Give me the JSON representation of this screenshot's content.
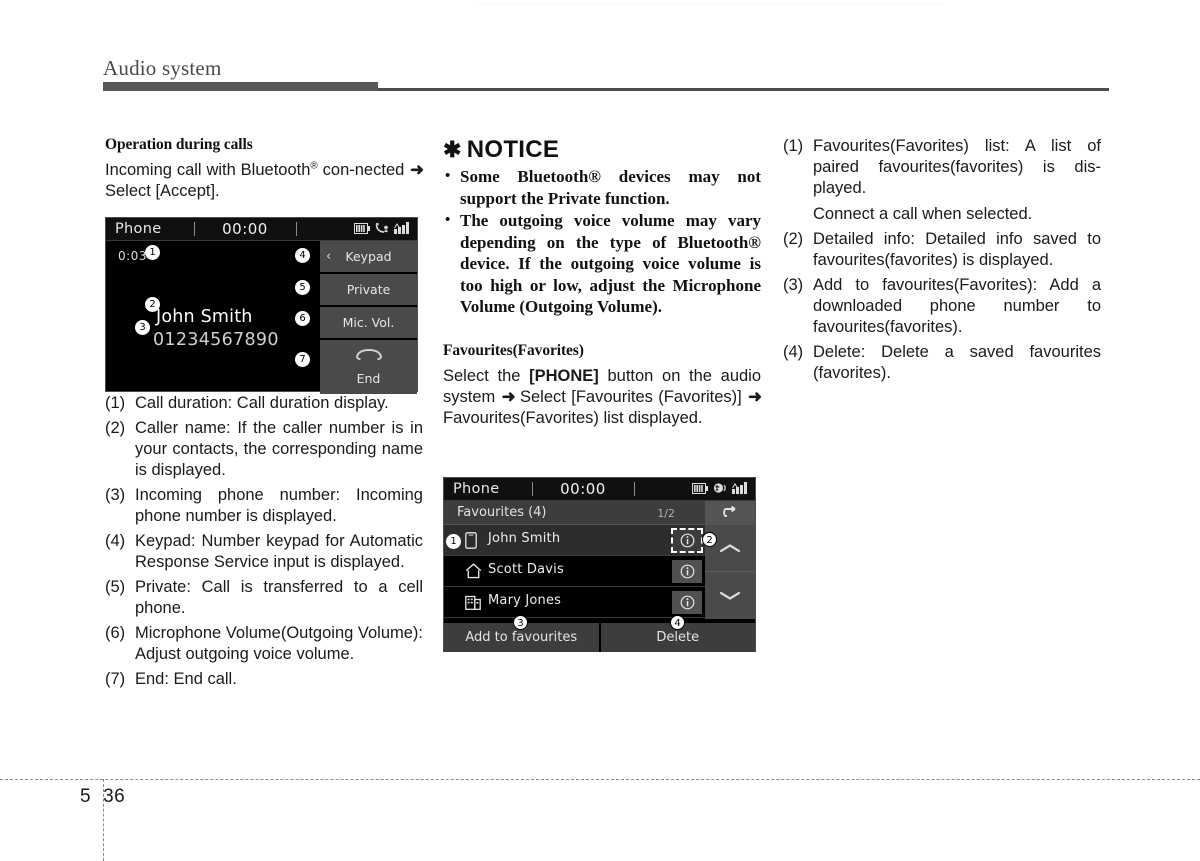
{
  "header": {
    "chapter_title": "Audio system"
  },
  "footer": {
    "chapter_number": "5",
    "page_number": "36"
  },
  "column1": {
    "section_title": "Operation during calls",
    "intro_before": "Incoming call with Bluetooth",
    "intro_reg": "®",
    "intro_after_1": " con-nected ",
    "arrow": "➜",
    "intro_after_2": " Select [Accept].",
    "intro_full": "Incoming call with Bluetooth® con-nected ➜ Select [Accept].",
    "call_screen": {
      "status_title": "Phone",
      "clock": "00:00",
      "icons": [
        "battery-icon",
        "bluetooth-phone-icon",
        "signal-bars-icon"
      ],
      "call_duration": "0:03",
      "caller_name": "John Smith",
      "caller_number": "01234567890",
      "buttons": {
        "keypad": "Keypad",
        "private": "Private",
        "mic_vol": "Mic. Vol.",
        "end": "End"
      },
      "callouts": [
        "1",
        "2",
        "3",
        "4",
        "5",
        "6",
        "7"
      ]
    },
    "items": [
      {
        "marker": "(1)",
        "text": "Call duration: Call duration display."
      },
      {
        "marker": "(2)",
        "text": "Caller name: If the caller number is in your contacts, the corresponding name is displayed."
      },
      {
        "marker": "(3)",
        "text": "Incoming phone number: Incoming phone number is displayed."
      },
      {
        "marker": "(4)",
        "text": "Keypad: Number keypad for Automatic Response Service input is displayed."
      },
      {
        "marker": "(5)",
        "text": "Private: Call is transferred to a cell phone."
      },
      {
        "marker": "(6)",
        "text": "Microphone Volume(Outgoing Volume): Adjust outgoing voice volume."
      },
      {
        "marker": "(7)",
        "text": "End: End call."
      }
    ]
  },
  "column2": {
    "notice_star": "✱",
    "notice_title": "NOTICE",
    "notice_items": [
      "Some Bluetooth® devices may not support the Private function.",
      "The outgoing voice volume may vary depending on the type of Bluetooth® device. If the outgoing voice volume is too high or low, adjust the Microphone Volume (Outgoing Volume)."
    ],
    "section_title": "Favourites(Favorites)",
    "body_part1": "Select the ",
    "body_phone_btn": "[PHONE]",
    "body_part2": " button on the audio system ",
    "body_part3": " Select [Favourites (Favorites)] ",
    "body_part4": " Favourites(Favorites) list displayed.",
    "fav_screen": {
      "status_title": "Phone",
      "clock": "00:00",
      "icons": [
        "battery-icon",
        "bluetooth-mic-icon",
        "signal-bars-icon"
      ],
      "list_title": "Favourites (4)",
      "page_indicator": "1/2",
      "rows": [
        {
          "name": "John Smith",
          "icon": "mobile-phone-icon",
          "selected": true
        },
        {
          "name": "Scott Davis",
          "icon": "home-icon",
          "selected": false
        },
        {
          "name": "Mary Jones",
          "icon": "office-building-icon",
          "selected": false
        }
      ],
      "footer_buttons": {
        "add": "Add to favourites",
        "delete": "Delete"
      },
      "callouts": [
        "1",
        "2",
        "3",
        "4"
      ]
    }
  },
  "column3": {
    "items": [
      {
        "marker": "(1)",
        "text": "Favourites(Favorites) list: A list of paired favourites(favorites) is dis-played.",
        "sub": "Connect a call when selected."
      },
      {
        "marker": "(2)",
        "text": "Detailed info: Detailed info saved to favourites(favorites) is displayed."
      },
      {
        "marker": "(3)",
        "text": "Add to favourites(Favorites): Add a downloaded phone number to favourites(favorites)."
      },
      {
        "marker": "(4)",
        "text": "Delete: Delete a saved favourites (favorites)."
      }
    ]
  }
}
